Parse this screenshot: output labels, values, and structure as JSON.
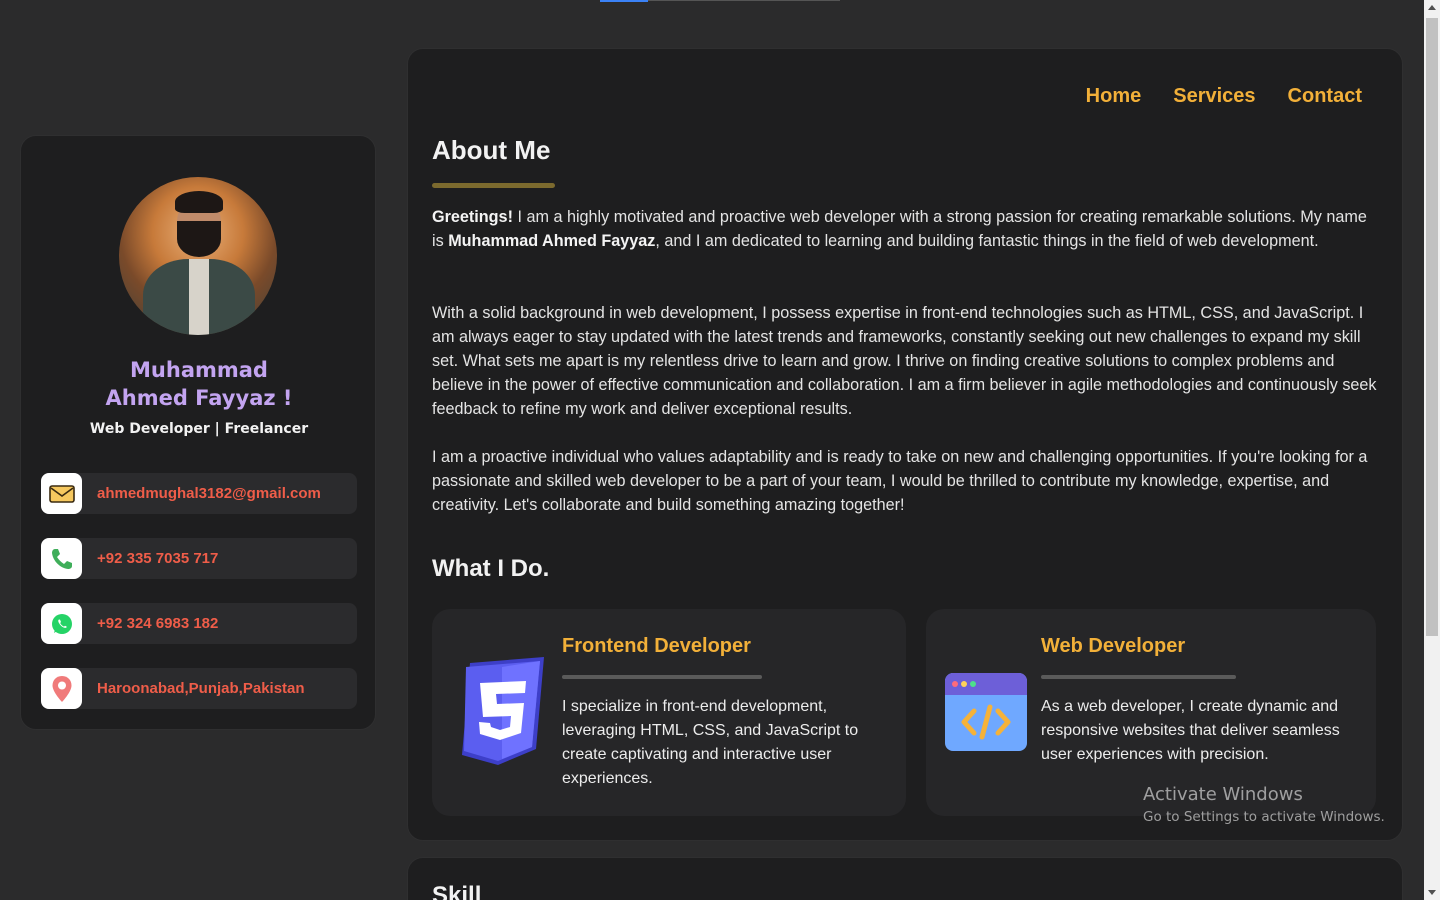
{
  "profile": {
    "name_line1": "Muhammad",
    "name_line2": "Ahmed Fayyaz !",
    "role": "Web Developer | Freelancer"
  },
  "contacts": [
    {
      "icon": "mail-icon",
      "text": "ahmedmughal3182@gmail.com"
    },
    {
      "icon": "phone-icon",
      "text": "+92 335 7035 717"
    },
    {
      "icon": "whatsapp-icon",
      "text": "+92 324 6983 182"
    },
    {
      "icon": "location-icon",
      "text": "Haroonabad,Punjab,Pakistan"
    }
  ],
  "nav": {
    "home": "Home",
    "services": "Services",
    "contact": "Contact"
  },
  "about": {
    "title": "About Me",
    "p1_lead": "Greetings!",
    "p1_a": " I am a highly motivated and proactive web developer with a strong passion for creating remarkable solutions. My name is ",
    "p1_name": "Muhammad Ahmed Fayyaz",
    "p1_b": ", and I am dedicated to learning and building fantastic things in the field of web development.",
    "p2": "With a solid background in web development, I possess expertise in front-end technologies such as HTML, CSS, and JavaScript. I am always eager to stay updated with the latest trends and frameworks, constantly seeking out new challenges to expand my skill set. What sets me apart is my relentless drive to learn and grow. I thrive on finding creative solutions to complex problems and believe in the power of effective communication and collaboration. I am a firm believer in agile methodologies and continuously seek feedback to refine my work and deliver exceptional results.",
    "p3": "I am a proactive individual who values adaptability and is ready to take on new and challenging opportunities. If you're looking for a passionate and skilled web developer to be a part of your team, I would be thrilled to contribute my knowledge, expertise, and creativity. Let's collaborate and build something amazing together!"
  },
  "what_i_do": {
    "title": "What I Do.",
    "services": [
      {
        "icon": "css3-icon",
        "title": "Frontend Developer",
        "desc": "I specialize in front-end development, leveraging HTML, CSS, and JavaScript to create captivating and interactive user experiences."
      },
      {
        "icon": "code-window-icon",
        "title": "Web Developer",
        "desc": "As a web developer, I create dynamic and responsive websites that deliver seamless user experiences with precision."
      }
    ]
  },
  "skill": {
    "title": "Skill"
  },
  "watermark": {
    "line1": "Activate Windows",
    "line2": "Go to Settings to activate Windows."
  },
  "colors": {
    "accent": "#f2b039",
    "name": "#c3a4f0",
    "contact_text": "#ef5d49",
    "background": "#2b2b2c",
    "card": "#1e1e1f"
  }
}
